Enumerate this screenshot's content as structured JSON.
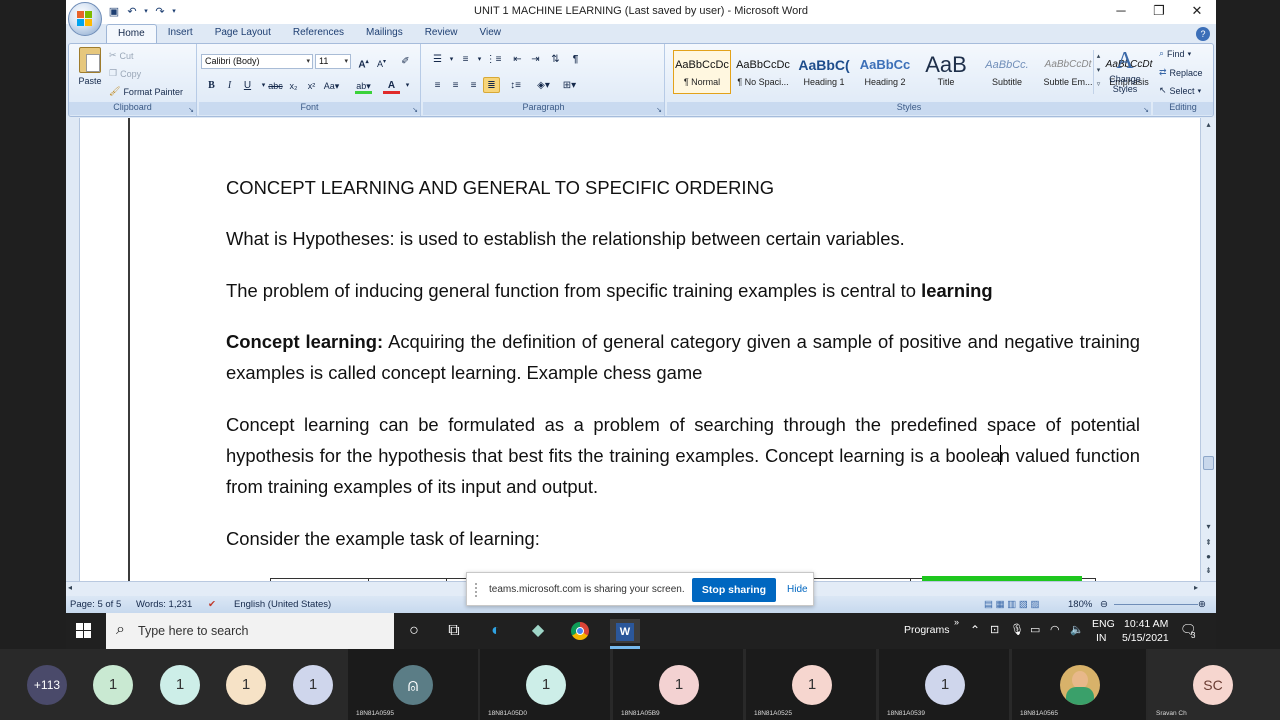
{
  "window": {
    "title": "UNIT 1 MACHINE LEARNING (Last saved by user) - Microsoft Word",
    "controls": [
      "─",
      "❐",
      "✕"
    ]
  },
  "ribbon": {
    "tabs": [
      "Home",
      "Insert",
      "Page Layout",
      "References",
      "Mailings",
      "Review",
      "View"
    ],
    "clipboard": {
      "paste": "Paste",
      "cut": "Cut",
      "copy": "Copy",
      "format_painter": "Format Painter",
      "label": "Clipboard"
    },
    "font": {
      "name": "Calibri (Body)",
      "size": "11",
      "label": "Font"
    },
    "paragraph": {
      "label": "Paragraph"
    },
    "styles": {
      "label": "Styles",
      "items": [
        {
          "preview": "AaBbCcDc",
          "name": "¶ Normal"
        },
        {
          "preview": "AaBbCcDc",
          "name": "¶ No Spaci..."
        },
        {
          "preview": "AaBbC(",
          "name": "Heading 1"
        },
        {
          "preview": "AaBbCc",
          "name": "Heading 2"
        },
        {
          "preview": "AaB",
          "name": "Title"
        },
        {
          "preview": "AaBbCc.",
          "name": "Subtitle"
        },
        {
          "preview": "AaBbCcDt",
          "name": "Subtle Em..."
        },
        {
          "preview": "AaBbCcDt",
          "name": "Emphasis"
        }
      ],
      "change_styles": "Change Styles"
    },
    "editing": {
      "find": "Find",
      "replace": "Replace",
      "select": "Select",
      "label": "Editing"
    }
  },
  "document": {
    "heading": "CONCEPT LEARNING AND GENERAL TO SPECIFIC ORDERING",
    "p1": "What is Hypotheses: is used to establish the relationship between certain variables.",
    "p2_start": "The problem of inducing general function from specific training examples is central to ",
    "p2_bold": "learning",
    "p3_bold": "Concept learning:",
    "p3_rest": " Acquiring the definition of general category given a sample of positive and negative training examples is called concept learning. Example chess game",
    "p4_before_cursor": "Concept learning can be formulated as a problem of searching through the predefined space of potential hypothesis for the hypothesis that best fits the training examples. Concept learning is a boolea",
    "p4_after_cursor": "n valued function from training examples of its input and output.",
    "p5": "Consider the example task of learning:"
  },
  "status": {
    "page": "Page: 5 of 5",
    "words": "Words: 1,231",
    "language": "English (United States)",
    "zoom": "180%"
  },
  "share_banner": {
    "message": "teams.microsoft.com is sharing your screen.",
    "stop": "Stop sharing",
    "hide": "Hide"
  },
  "taskbar": {
    "search_placeholder": "Type here to search",
    "programs": "Programs",
    "lang_top": "ENG",
    "lang_bottom": "IN",
    "time": "10:41 AM",
    "date": "5/15/2021",
    "notif_count": "3"
  },
  "participants": [
    {
      "initials": "+113",
      "label": "",
      "color": "#4a4a6a"
    },
    {
      "initials": "1",
      "label": "",
      "color": "#c9e9d2"
    },
    {
      "initials": "1",
      "label": "",
      "color": "#cdeee8"
    },
    {
      "initials": "1",
      "label": "",
      "color": "#f6e2c6"
    },
    {
      "initials": "1",
      "label": "",
      "color": "#cfd6ec"
    },
    {
      "initials": "",
      "label": "18N81A0595",
      "color": "#5b7d86"
    },
    {
      "initials": "1",
      "label": "18N81A05D0",
      "color": "#cdeee8"
    },
    {
      "initials": "1",
      "label": "18N81A05B9",
      "color": "#f3d2d2"
    },
    {
      "initials": "1",
      "label": "18N81A0525",
      "color": "#f6d6cf"
    },
    {
      "initials": "1",
      "label": "18N81A0539",
      "color": "#cfd6ec"
    },
    {
      "initials": "",
      "label": "18N81A0565",
      "color": "#d8b26a"
    },
    {
      "initials": "SC",
      "label": "Sravan Ch",
      "color": "#f6d6cf"
    }
  ]
}
